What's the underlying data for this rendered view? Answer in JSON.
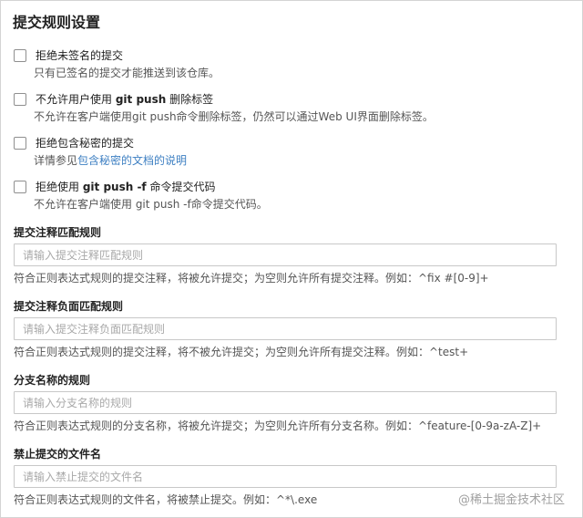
{
  "page": {
    "title": "提交规则设置"
  },
  "checkboxes": [
    {
      "label_pre": "拒绝未签名的提交",
      "label_bold": "",
      "label_post": "",
      "desc_pre": "只有已签名的提交才能推送到该仓库。",
      "desc_link": "",
      "checked": false
    },
    {
      "label_pre": "不允许用户使用 ",
      "label_bold": "git push",
      "label_post": " 删除标签",
      "desc_pre": "不允许在客户端使用git push命令删除标签，仍然可以通过Web UI界面删除标签。",
      "desc_link": "",
      "checked": false
    },
    {
      "label_pre": "拒绝包含秘密的提交",
      "label_bold": "",
      "label_post": "",
      "desc_pre": "详情参见",
      "desc_link": "包含秘密的文档的说明",
      "checked": false
    },
    {
      "label_pre": "拒绝使用 ",
      "label_bold": "git push -f",
      "label_post": " 命令提交代码",
      "desc_pre": "不允许在客户端使用 git push -f命令提交代码。",
      "desc_link": "",
      "checked": false
    }
  ],
  "rules": [
    {
      "title": "提交注释匹配规则",
      "placeholder": "请输入提交注释匹配规则",
      "value": "",
      "hint": "符合正则表达式规则的提交注释，将被允许提交；为空则允许所有提交注释。例如：^fix #[0-9]+"
    },
    {
      "title": "提交注释负面匹配规则",
      "placeholder": "请输入提交注释负面匹配规则",
      "value": "",
      "hint": "符合正则表达式规则的提交注释，将不被允许提交；为空则允许所有提交注释。例如：^test+"
    },
    {
      "title": "分支名称的规则",
      "placeholder": "请输入分支名称的规则",
      "value": "",
      "hint": "符合正则表达式规则的分支名称，将被允许提交；为空则允许所有分支名称。例如：^feature-[0-9a-zA-Z]+"
    },
    {
      "title": "禁止提交的文件名",
      "placeholder": "请输入禁止提交的文件名",
      "value": "",
      "hint": "符合正则表达式规则的文件名，将被禁止提交。例如：^*\\.exe"
    }
  ],
  "watermark": "@稀土掘金技术社区"
}
